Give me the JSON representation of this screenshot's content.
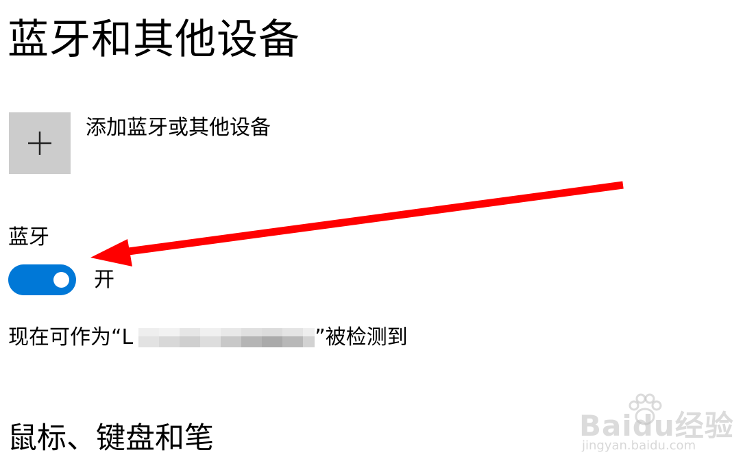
{
  "page": {
    "title": "蓝牙和其他设备"
  },
  "add_device": {
    "icon": "plus-icon",
    "label": "添加蓝牙或其他设备"
  },
  "bluetooth": {
    "section_label": "蓝牙",
    "toggle_on": true,
    "toggle_state_label": "开",
    "discoverable_prefix": "现在可作为“L",
    "discoverable_suffix": "”被检测到"
  },
  "mouse_keyboard_pen": {
    "title": "鼠标、键盘和笔"
  },
  "colors": {
    "accent": "#0078d7",
    "add_button_bg": "#cccccc",
    "annotation_arrow": "#ff0000"
  },
  "watermark": {
    "brand": "Baidu经验",
    "url": "jingyan.baidu.com"
  }
}
